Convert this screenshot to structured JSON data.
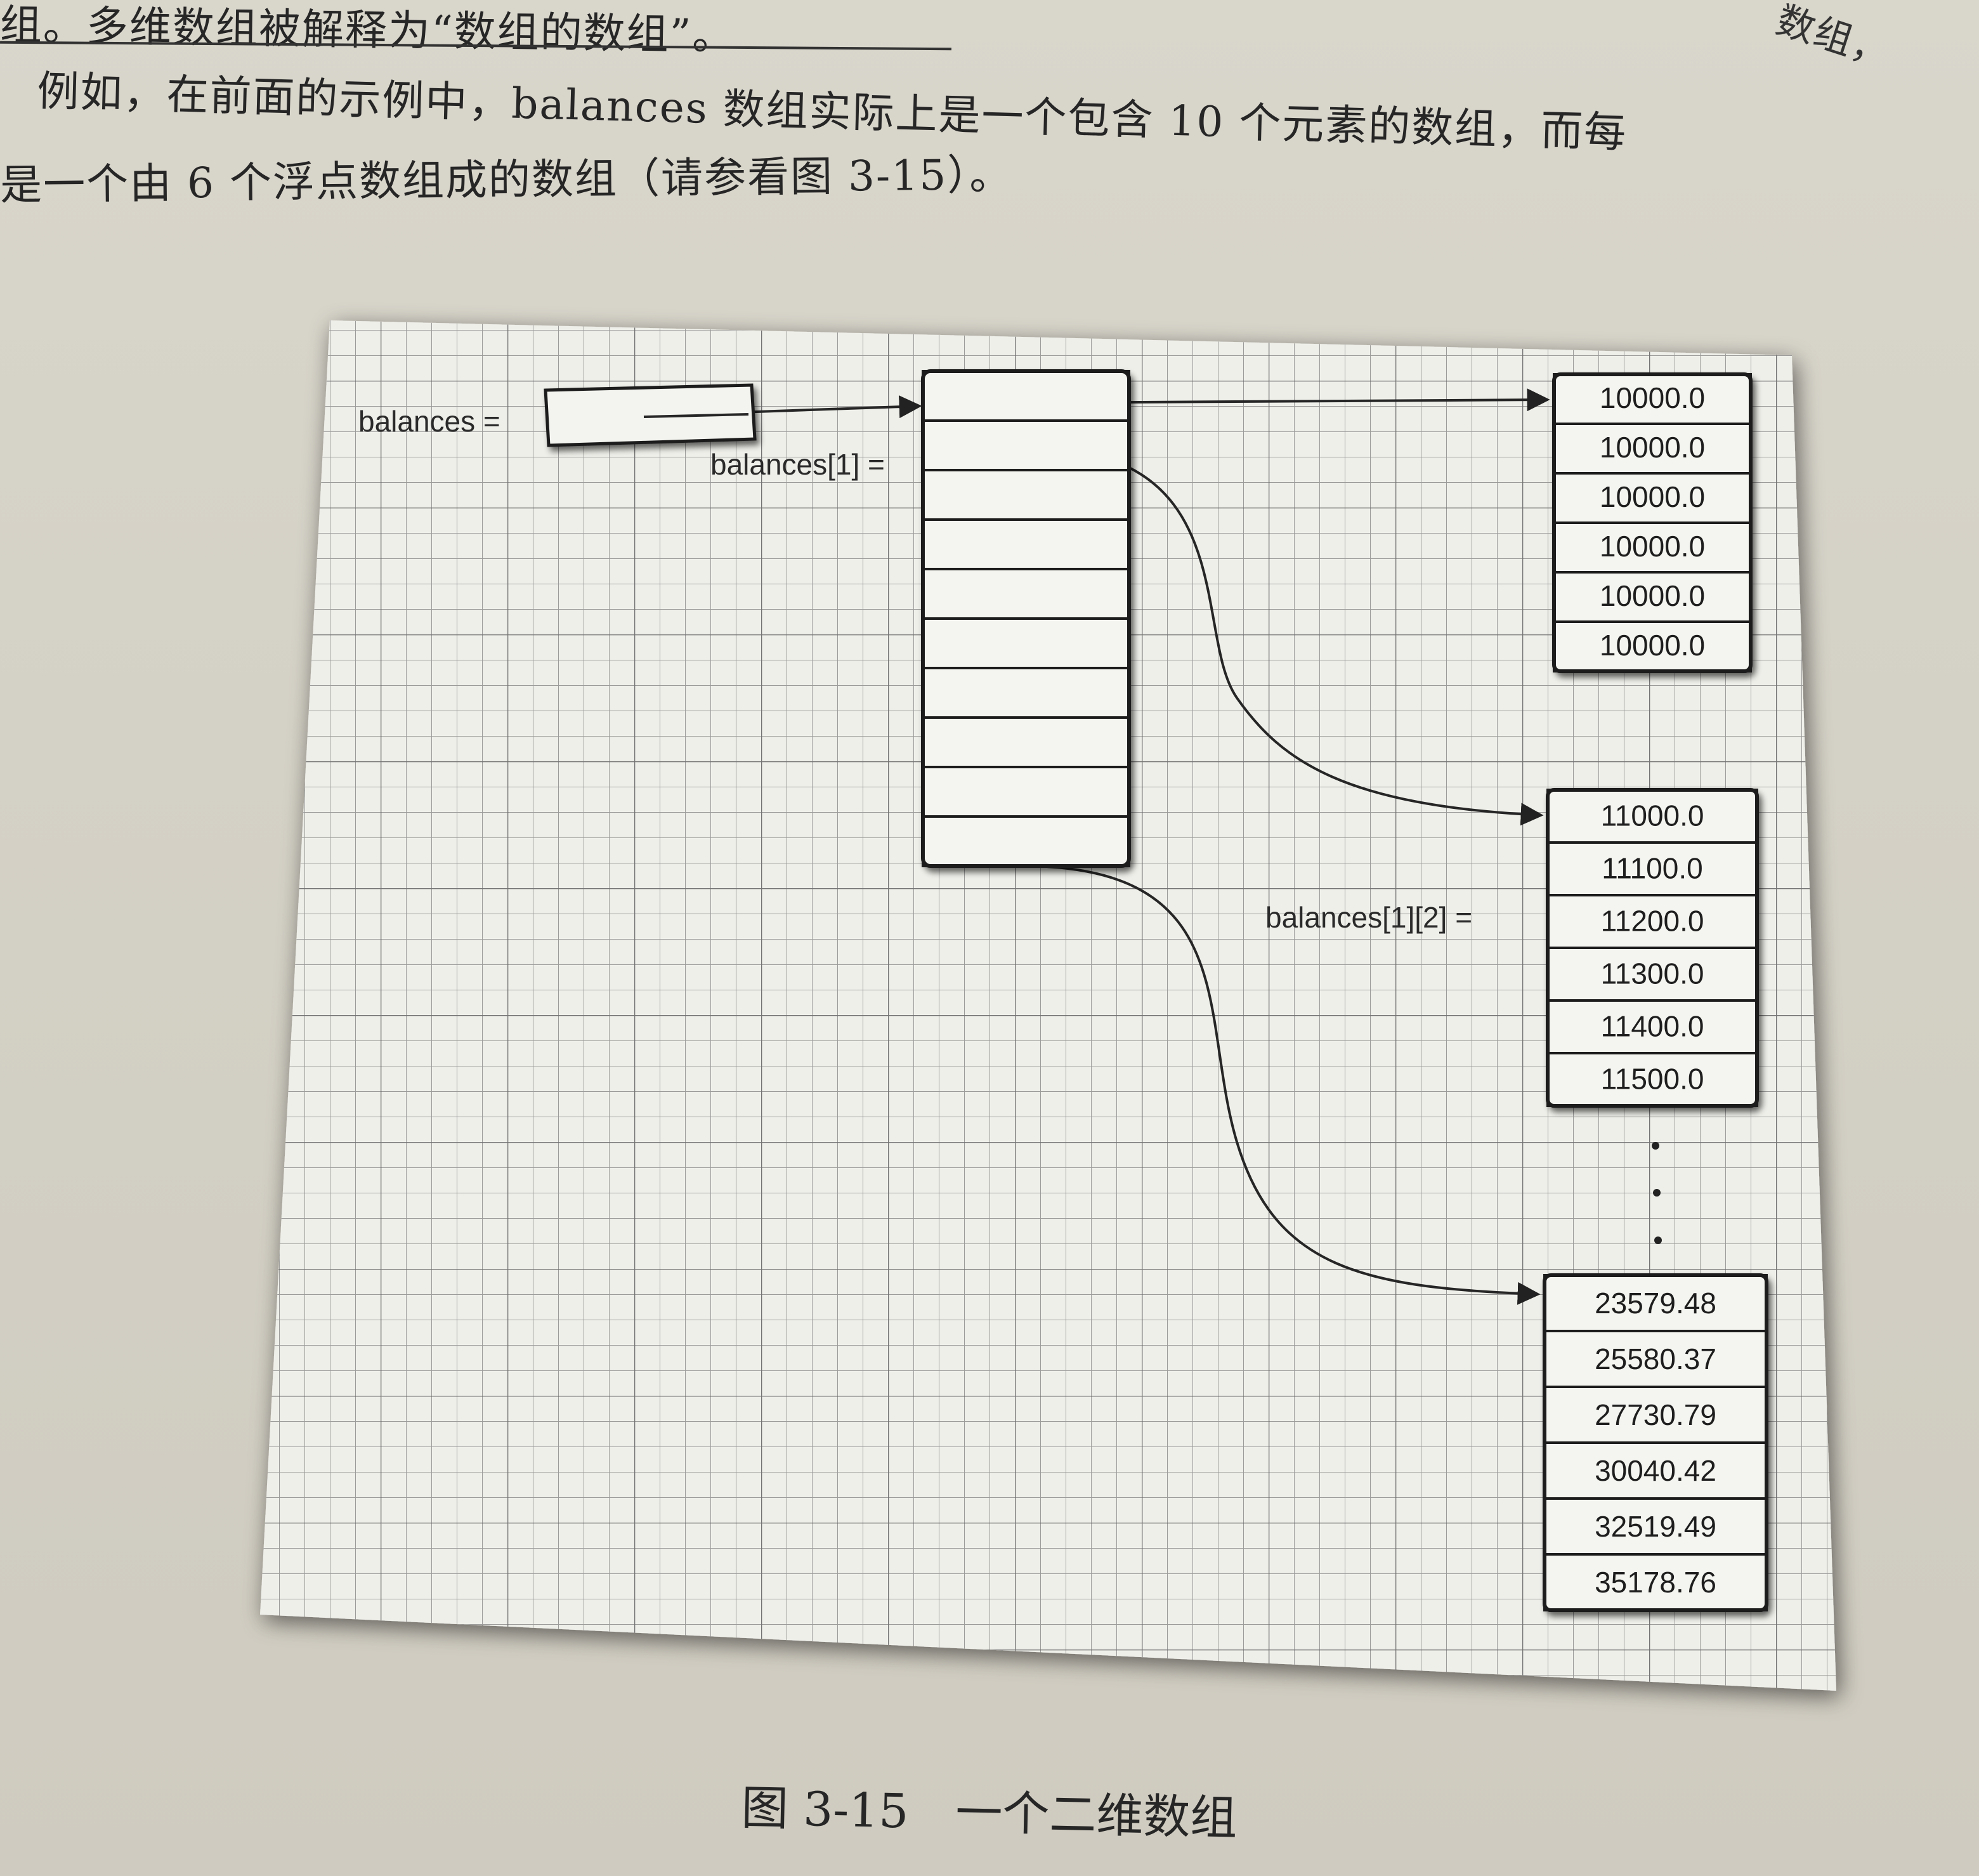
{
  "text": {
    "line1": "组。多维数组被解释为“数组的数组”。",
    "line2": "例如，在前面的示例中，balances 数组实际上是一个包含 10 个元素的数组，而每",
    "line3": "是一个由 6 个浮点数组成的数组（请参看图 3-15）。",
    "right_fragment": "数组，"
  },
  "figure": {
    "labels": {
      "balances": "balances =",
      "balances_1": "balances[1] =",
      "balances_1_2": "balances[1][2] ="
    },
    "row_arrays": [
      {
        "name": "row-0",
        "values": [
          "10000.0",
          "10000.0",
          "10000.0",
          "10000.0",
          "10000.0",
          "10000.0"
        ]
      },
      {
        "name": "row-1",
        "values": [
          "11000.0",
          "11100.0",
          "11200.0",
          "11300.0",
          "11400.0",
          "11500.0"
        ]
      },
      {
        "name": "row-9",
        "values": [
          "23579.48",
          "25580.37",
          "27730.79",
          "30040.42",
          "32519.49",
          "35178.76"
        ]
      }
    ],
    "outer_array_length": 10,
    "ellipsis": "·"
  },
  "caption": "图 3-15　一个二维数组"
}
